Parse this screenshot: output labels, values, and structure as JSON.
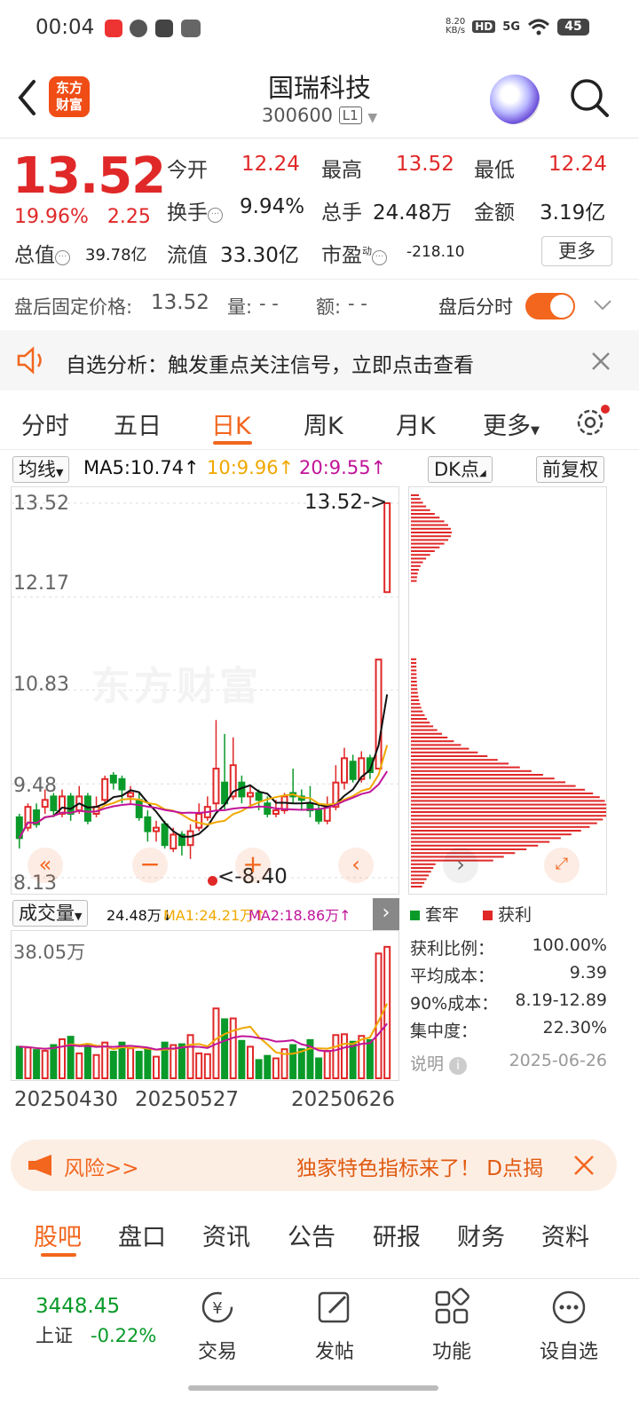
{
  "status_bar": {
    "time": "00:04",
    "net_speed": "8.20\nKB/s",
    "net_speed_top": "8.20",
    "net_speed_bottom": "KB/s",
    "hd": "HD",
    "signal": "5G",
    "battery": "45"
  },
  "header": {
    "back_icon": "chevron-left-icon",
    "logo_line1": "东方",
    "logo_line2": "财富",
    "title": "国瑞科技",
    "code": "300600",
    "level": "L1"
  },
  "quote": {
    "price": "13.52",
    "change_pct": "19.96%",
    "change": "2.25",
    "open_label": "今开",
    "open": "12.24",
    "high_label": "最高",
    "high": "13.52",
    "low_label": "最低",
    "low": "12.24",
    "turnover_label": "换手",
    "turnover": "9.94%",
    "volume_label": "总手",
    "volume": "24.48万",
    "amount_label": "金额",
    "amount": "3.19亿",
    "mcap_label": "总值",
    "mcap": "39.78亿",
    "float_label": "流值",
    "float": "33.30亿",
    "pe_label": "市盈",
    "pe_sup": "动",
    "pe": "-218.10",
    "more": "更多"
  },
  "after_hours": {
    "label": "盘后固定价格:",
    "price": "13.52",
    "vol_label": "量:",
    "vol": "- -",
    "amt_label": "额:",
    "amt": "- -",
    "toggle_label": "盘后分时",
    "toggle_on": true
  },
  "alert": {
    "text": "自选分析：触发重点关注信号，立即点击查看"
  },
  "kline_tabs": [
    "分时",
    "五日",
    "日K",
    "周K",
    "月K",
    "更多"
  ],
  "active_tab": "日K",
  "ma": {
    "select": "均线",
    "ma5": "MA5:10.74↑",
    "ma10": "10:9.96↑",
    "ma20": "20:9.55↑",
    "dk": "DK点",
    "adjust": "前复权"
  },
  "chart_labels": {
    "y1": "13.52",
    "y2": "12.17",
    "y3": "10.83",
    "y4": "9.48",
    "y5": "8.13",
    "top_mark": "13.52->",
    "low_mark": "<-8.40",
    "watermark": "东方财富"
  },
  "volume_bar": {
    "select": "成交量",
    "vol": "24.48万↓",
    "ma1": "MA1:24.21万↑",
    "ma2": "MA2:18.86万↑",
    "y_max": "38.05万"
  },
  "dates": [
    "20250430",
    "20250527",
    "20250626"
  ],
  "cost": {
    "legend_trapped": "套牢",
    "legend_profit": "获利",
    "rows": [
      {
        "k": "获利比例：",
        "v": "100.00%"
      },
      {
        "k": "平均成本：",
        "v": "9.39"
      },
      {
        "k": "90%成本：",
        "v": "8.19-12.89"
      },
      {
        "k": "集中度：",
        "v": "22.30%"
      }
    ],
    "note_label": "说明",
    "date": "2025-06-26"
  },
  "risk": {
    "left": "风险>>",
    "right": "独家特色指标来了！ D点揭"
  },
  "bottom_tabs": [
    "股吧",
    "盘口",
    "资讯",
    "公告",
    "研报",
    "财务",
    "资料"
  ],
  "nav": {
    "index_value": "3448.45",
    "index_name": "上证",
    "index_change": "-0.22%",
    "items": [
      "交易",
      "发帖",
      "功能",
      "设自选"
    ]
  },
  "colors": {
    "up": "#e02828",
    "down": "#0a9a2a",
    "accent": "#f2661e",
    "ma5": "#111111",
    "ma10": "#f0a800",
    "ma20": "#c0149a"
  },
  "chart_data": {
    "type": "candlestick",
    "title": "",
    "y_ticks": [
      13.52,
      12.17,
      10.83,
      9.48,
      8.13
    ],
    "ylim": [
      8.13,
      13.52
    ],
    "candles": [
      [
        9.0,
        8.7,
        9.05,
        8.55
      ],
      [
        8.85,
        9.15,
        9.2,
        8.8
      ],
      [
        9.1,
        8.9,
        9.2,
        8.85
      ],
      [
        9.15,
        9.25,
        9.4,
        9.05
      ],
      [
        9.3,
        9.1,
        9.35,
        9.0
      ],
      [
        9.05,
        9.3,
        9.4,
        9.0
      ],
      [
        9.3,
        9.05,
        9.35,
        8.95
      ],
      [
        9.1,
        9.3,
        9.45,
        9.05
      ],
      [
        9.3,
        8.95,
        9.35,
        8.9
      ],
      [
        9.05,
        9.15,
        9.3,
        9.0
      ],
      [
        9.25,
        9.55,
        9.6,
        9.2
      ],
      [
        9.6,
        9.5,
        9.65,
        9.4
      ],
      [
        9.55,
        9.4,
        9.6,
        9.2
      ],
      [
        9.3,
        9.35,
        9.45,
        9.2
      ],
      [
        9.25,
        9.0,
        9.35,
        8.95
      ],
      [
        9.0,
        8.8,
        9.1,
        8.65
      ],
      [
        8.8,
        8.85,
        8.95,
        8.65
      ],
      [
        8.9,
        8.6,
        8.95,
        8.55
      ],
      [
        8.55,
        8.75,
        8.85,
        8.5
      ],
      [
        8.75,
        8.6,
        8.8,
        8.45
      ],
      [
        8.6,
        8.8,
        8.9,
        8.4
      ],
      [
        8.85,
        9.05,
        9.2,
        8.8
      ],
      [
        9.0,
        9.15,
        9.3,
        8.95
      ],
      [
        9.2,
        9.7,
        10.4,
        9.1
      ],
      [
        9.5,
        9.2,
        10.2,
        9.1
      ],
      [
        9.3,
        9.75,
        10.15,
        9.25
      ],
      [
        9.5,
        9.3,
        9.6,
        9.2
      ],
      [
        9.3,
        9.35,
        9.45,
        9.15
      ],
      [
        9.35,
        9.25,
        9.4,
        9.1
      ],
      [
        9.2,
        9.05,
        9.3,
        9.0
      ],
      [
        9.05,
        9.1,
        9.25,
        9.0
      ],
      [
        9.1,
        9.3,
        9.35,
        9.05
      ],
      [
        9.35,
        9.3,
        9.7,
        9.2
      ],
      [
        9.3,
        9.25,
        9.4,
        9.1
      ],
      [
        9.2,
        9.1,
        9.45,
        9.0
      ],
      [
        9.1,
        8.95,
        9.2,
        8.9
      ],
      [
        8.95,
        9.15,
        9.3,
        8.9
      ],
      [
        9.15,
        9.5,
        9.75,
        9.1
      ],
      [
        9.5,
        9.85,
        10.0,
        9.4
      ],
      [
        9.8,
        9.55,
        9.9,
        9.5
      ],
      [
        9.55,
        9.85,
        9.95,
        9.5
      ],
      [
        9.85,
        9.65,
        9.9,
        9.55
      ],
      [
        9.7,
        11.27,
        11.27,
        9.7
      ],
      [
        12.24,
        13.52,
        13.52,
        12.24
      ]
    ]
  }
}
